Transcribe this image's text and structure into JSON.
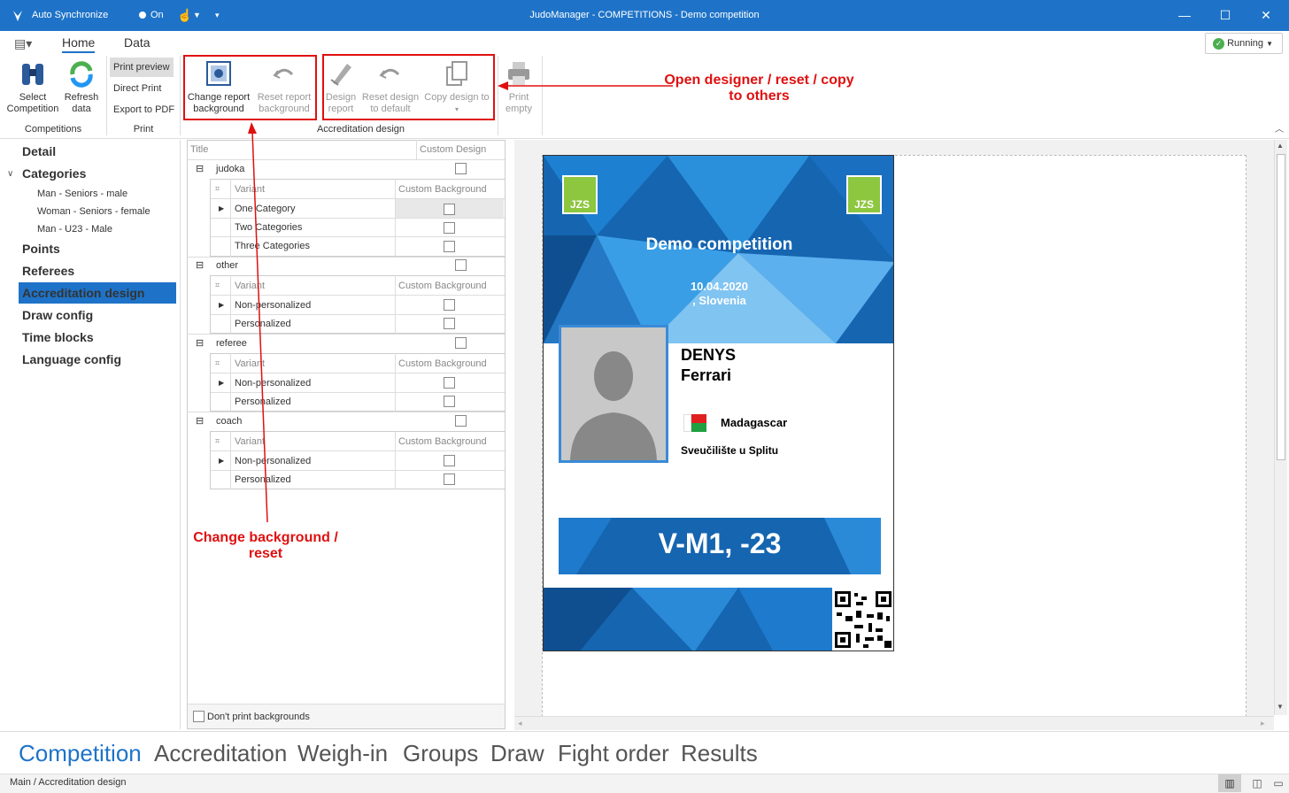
{
  "titlebar": {
    "auto_sync": "Auto Synchronize",
    "toggle": "On",
    "title": "JudoManager - COMPETITIONS - Demo competition"
  },
  "ribbon": {
    "tabs": [
      "Home",
      "Data"
    ],
    "status": "Running",
    "buttons": {
      "select_competition": "Select Competition",
      "refresh_data": "Refresh data",
      "print_preview": "Print preview",
      "direct_print": "Direct Print",
      "export_pdf": "Export to PDF",
      "change_bg": "Change report background",
      "reset_bg": "Reset report background",
      "design_report": "Design report",
      "reset_design": "Reset design to default",
      "copy_design": "Copy design to",
      "print_empty": "Print empty"
    },
    "groups": {
      "competitions": "Competitions",
      "print": "Print",
      "accreditation": "Accreditation design"
    }
  },
  "sidebar": {
    "items": [
      "Detail",
      "Categories",
      "Points",
      "Referees",
      "Accreditation design",
      "Draw config",
      "Time blocks",
      "Language config"
    ],
    "categories": [
      "Man - Seniors - male",
      "Woman - Seniors - female",
      "Man - U23 - Male"
    ],
    "selected": "Accreditation design"
  },
  "grid": {
    "col_title": "Title",
    "col_custom": "Custom Design",
    "sub_variant": "Variant",
    "sub_custom_bg": "Custom Background",
    "groups": [
      {
        "title": "judoka",
        "variants": [
          "One Category",
          "Two Categories",
          "Three Categories"
        ]
      },
      {
        "title": "other",
        "variants": [
          "Non-personalized",
          "Personalized"
        ]
      },
      {
        "title": "referee",
        "variants": [
          "Non-personalized",
          "Personalized"
        ]
      },
      {
        "title": "coach",
        "variants": [
          "Non-personalized",
          "Personalized"
        ]
      }
    ],
    "footer_checkbox": "Don't print backgrounds"
  },
  "card": {
    "title": "Demo competition",
    "date": "10.04.2020",
    "location": ", Slovenia",
    "first_name": "DENYS",
    "last_name": "Ferrari",
    "country": "Madagascar",
    "club": "Sveučilište u Splitu",
    "category": "V-M1, -23",
    "logo_text": "JZS"
  },
  "annotations": {
    "designer": "Open designer / reset / copy to others",
    "background": "Change background / reset"
  },
  "bottom_tabs": [
    "Competition",
    "Accreditation",
    "Weigh-in",
    "Groups",
    "Draw",
    "Fight order",
    "Results"
  ],
  "statusbar": {
    "breadcrumb": "Main / Accreditation design"
  },
  "colors": {
    "accent": "#1E73C8",
    "annotation": "#E01010"
  }
}
